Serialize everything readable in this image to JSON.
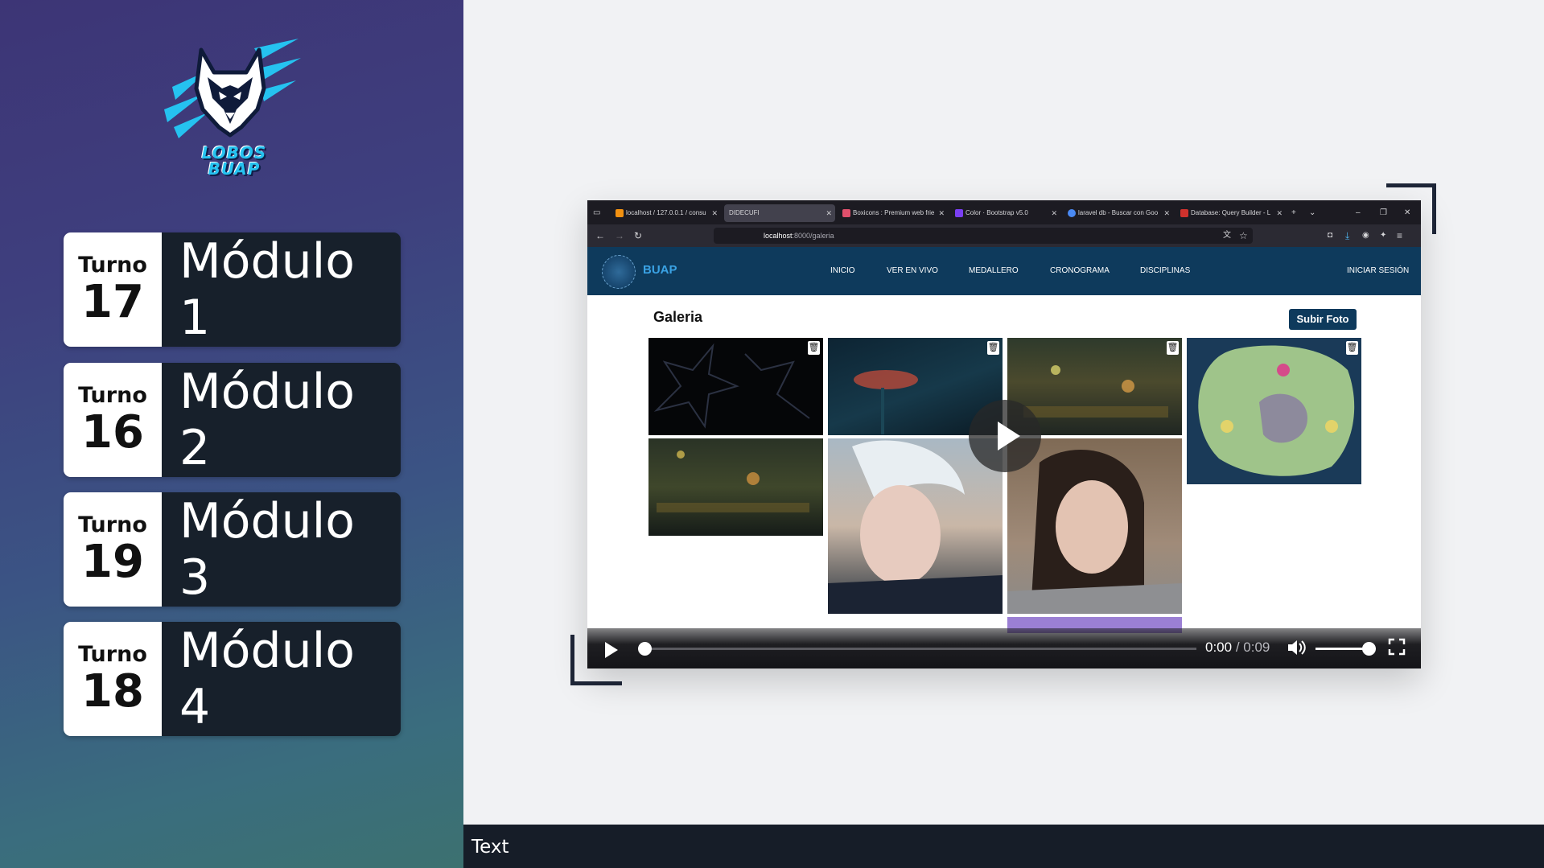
{
  "sidebar": {
    "logo": {
      "line1": "LOBOS",
      "line2": "BUAP",
      "icon": "wolf-head-icon"
    },
    "modules": [
      {
        "turno_label": "Turno",
        "turno_num": "17",
        "name": "Módulo 1"
      },
      {
        "turno_label": "Turno",
        "turno_num": "16",
        "name": "Módulo 2"
      },
      {
        "turno_label": "Turno",
        "turno_num": "19",
        "name": "Módulo 3"
      },
      {
        "turno_label": "Turno",
        "turno_num": "18",
        "name": "Módulo 4"
      }
    ]
  },
  "browser": {
    "tabs": [
      "localhost / 127.0.0.1 / consu",
      "DIDECUFI",
      "Boxicons : Premium web frie",
      "Color · Bootstrap v5.0",
      "laravel db - Buscar con Goo",
      "Database: Query Builder - L"
    ],
    "url_host": "localhost",
    "url_path": ":8000/galeria"
  },
  "site": {
    "brand": "BUAP",
    "nav": [
      "INICIO",
      "VER EN VIVO",
      "MEDALLERO",
      "CRONOGRAMA",
      "DISCIPLINAS"
    ],
    "login": "INICIAR SESIÓN",
    "page_title": "Galeria",
    "upload_button": "Subir Foto"
  },
  "video": {
    "current_time": "0:00",
    "separator": "/",
    "duration": "0:09",
    "progress": 0,
    "volume": 1.0
  },
  "caption": {
    "text": "Text"
  },
  "colors": {
    "sidebar_top": "#3d3576",
    "sidebar_bottom": "#3c7170",
    "module_dark": "#17202b",
    "site_nav": "#0e3a5c",
    "brand_blue": "#3aa2e4",
    "accent_cyan": "#25c2f0"
  }
}
